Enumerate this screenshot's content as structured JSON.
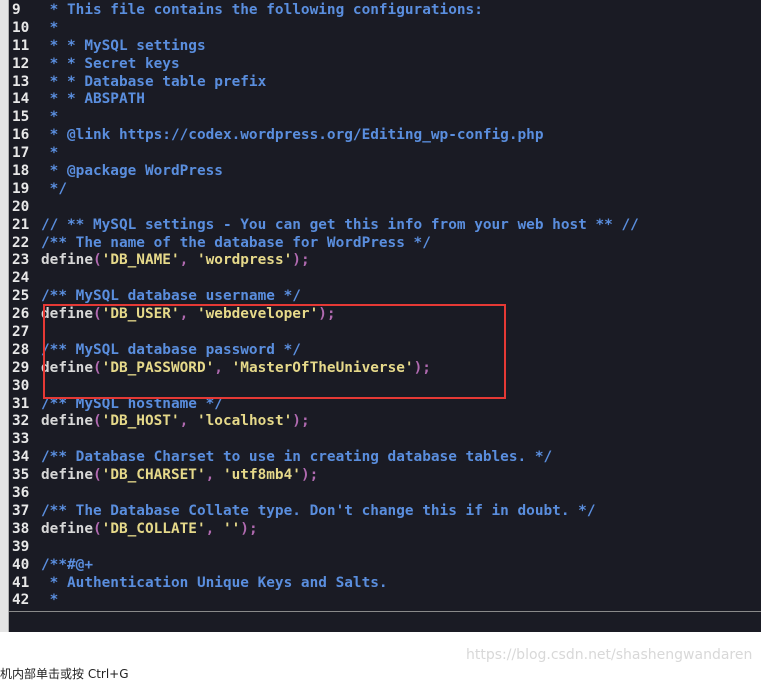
{
  "editor": {
    "lines": [
      {
        "num": "9",
        "parts": [
          {
            "c": "cmt",
            "t": " * This file contains the following configurations:"
          }
        ]
      },
      {
        "num": "10",
        "parts": [
          {
            "c": "cmt",
            "t": " *"
          }
        ]
      },
      {
        "num": "11",
        "parts": [
          {
            "c": "cmt",
            "t": " * * MySQL settings"
          }
        ]
      },
      {
        "num": "12",
        "parts": [
          {
            "c": "cmt",
            "t": " * * Secret keys"
          }
        ]
      },
      {
        "num": "13",
        "parts": [
          {
            "c": "cmt",
            "t": " * * Database table prefix"
          }
        ]
      },
      {
        "num": "14",
        "parts": [
          {
            "c": "cmt",
            "t": " * * ABSPATH"
          }
        ]
      },
      {
        "num": "15",
        "parts": [
          {
            "c": "cmt",
            "t": " *"
          }
        ]
      },
      {
        "num": "16",
        "parts": [
          {
            "c": "cmt",
            "t": " * @link https://codex.wordpress.org/Editing_wp-config.php"
          }
        ]
      },
      {
        "num": "17",
        "parts": [
          {
            "c": "cmt",
            "t": " *"
          }
        ]
      },
      {
        "num": "18",
        "parts": [
          {
            "c": "cmt",
            "t": " * @package WordPress"
          }
        ]
      },
      {
        "num": "19",
        "parts": [
          {
            "c": "cmt",
            "t": " */"
          }
        ]
      },
      {
        "num": "20",
        "parts": []
      },
      {
        "num": "21",
        "parts": [
          {
            "c": "cmt",
            "t": "// ** MySQL settings - You can get this info from your web host ** //"
          }
        ]
      },
      {
        "num": "22",
        "parts": [
          {
            "c": "cmt",
            "t": "/** The name of the database for WordPress */"
          }
        ]
      },
      {
        "num": "23",
        "parts": [
          {
            "c": "kw",
            "t": "define"
          },
          {
            "c": "punc",
            "t": "("
          },
          {
            "c": "str",
            "t": "'DB_NAME'"
          },
          {
            "c": "punc",
            "t": ", "
          },
          {
            "c": "str",
            "t": "'wordpress'"
          },
          {
            "c": "punc",
            "t": ");"
          }
        ]
      },
      {
        "num": "24",
        "parts": []
      },
      {
        "num": "25",
        "parts": [
          {
            "c": "cmt",
            "t": "/** MySQL database username */"
          }
        ]
      },
      {
        "num": "26",
        "parts": [
          {
            "c": "kw",
            "t": "define"
          },
          {
            "c": "punc",
            "t": "("
          },
          {
            "c": "str",
            "t": "'DB_USER'"
          },
          {
            "c": "punc",
            "t": ", "
          },
          {
            "c": "str",
            "t": "'webdeveloper'"
          },
          {
            "c": "punc",
            "t": ");"
          }
        ]
      },
      {
        "num": "27",
        "parts": []
      },
      {
        "num": "28",
        "parts": [
          {
            "c": "cmt",
            "t": "/** MySQL database password */"
          }
        ]
      },
      {
        "num": "29",
        "parts": [
          {
            "c": "kw",
            "t": "define"
          },
          {
            "c": "punc",
            "t": "("
          },
          {
            "c": "str",
            "t": "'DB_PASSWORD'"
          },
          {
            "c": "punc",
            "t": ", "
          },
          {
            "c": "str",
            "t": "'MasterOfTheUniverse'"
          },
          {
            "c": "punc",
            "t": ");"
          }
        ]
      },
      {
        "num": "30",
        "parts": []
      },
      {
        "num": "31",
        "parts": [
          {
            "c": "cmt",
            "t": "/** MySQL hostname */"
          }
        ]
      },
      {
        "num": "32",
        "parts": [
          {
            "c": "kw",
            "t": "define"
          },
          {
            "c": "punc",
            "t": "("
          },
          {
            "c": "str",
            "t": "'DB_HOST'"
          },
          {
            "c": "punc",
            "t": ", "
          },
          {
            "c": "str",
            "t": "'localhost'"
          },
          {
            "c": "punc",
            "t": ");"
          }
        ]
      },
      {
        "num": "33",
        "parts": []
      },
      {
        "num": "34",
        "parts": [
          {
            "c": "cmt",
            "t": "/** Database Charset to use in creating database tables. */"
          }
        ]
      },
      {
        "num": "35",
        "parts": [
          {
            "c": "kw",
            "t": "define"
          },
          {
            "c": "punc",
            "t": "("
          },
          {
            "c": "str",
            "t": "'DB_CHARSET'"
          },
          {
            "c": "punc",
            "t": ", "
          },
          {
            "c": "str",
            "t": "'utf8mb4'"
          },
          {
            "c": "punc",
            "t": ");"
          }
        ]
      },
      {
        "num": "36",
        "parts": []
      },
      {
        "num": "37",
        "parts": [
          {
            "c": "cmt",
            "t": "/** The Database Collate type. Don't change this if in doubt. */"
          }
        ]
      },
      {
        "num": "38",
        "parts": [
          {
            "c": "kw",
            "t": "define"
          },
          {
            "c": "punc",
            "t": "("
          },
          {
            "c": "str",
            "t": "'DB_COLLATE'"
          },
          {
            "c": "punc",
            "t": ", "
          },
          {
            "c": "str",
            "t": "''"
          },
          {
            "c": "punc",
            "t": ");"
          }
        ]
      },
      {
        "num": "39",
        "parts": []
      },
      {
        "num": "40",
        "parts": [
          {
            "c": "cmt",
            "t": "/**#@+"
          }
        ]
      },
      {
        "num": "41",
        "parts": [
          {
            "c": "cmt",
            "t": " * Authentication Unique Keys and Salts."
          }
        ]
      },
      {
        "num": "42",
        "parts": [
          {
            "c": "cmt",
            "t": " *"
          }
        ]
      }
    ]
  },
  "colors": {
    "background": "#1a1b24",
    "comment": "#5a8ede",
    "string": "#e6d98a",
    "punctuation": "#b06ab0",
    "highlight_box": "#e53935"
  },
  "watermark": "https://blog.csdn.net/shashengwandaren",
  "status_bar": {
    "text": "机内部单击或按 Ctrl+G"
  }
}
